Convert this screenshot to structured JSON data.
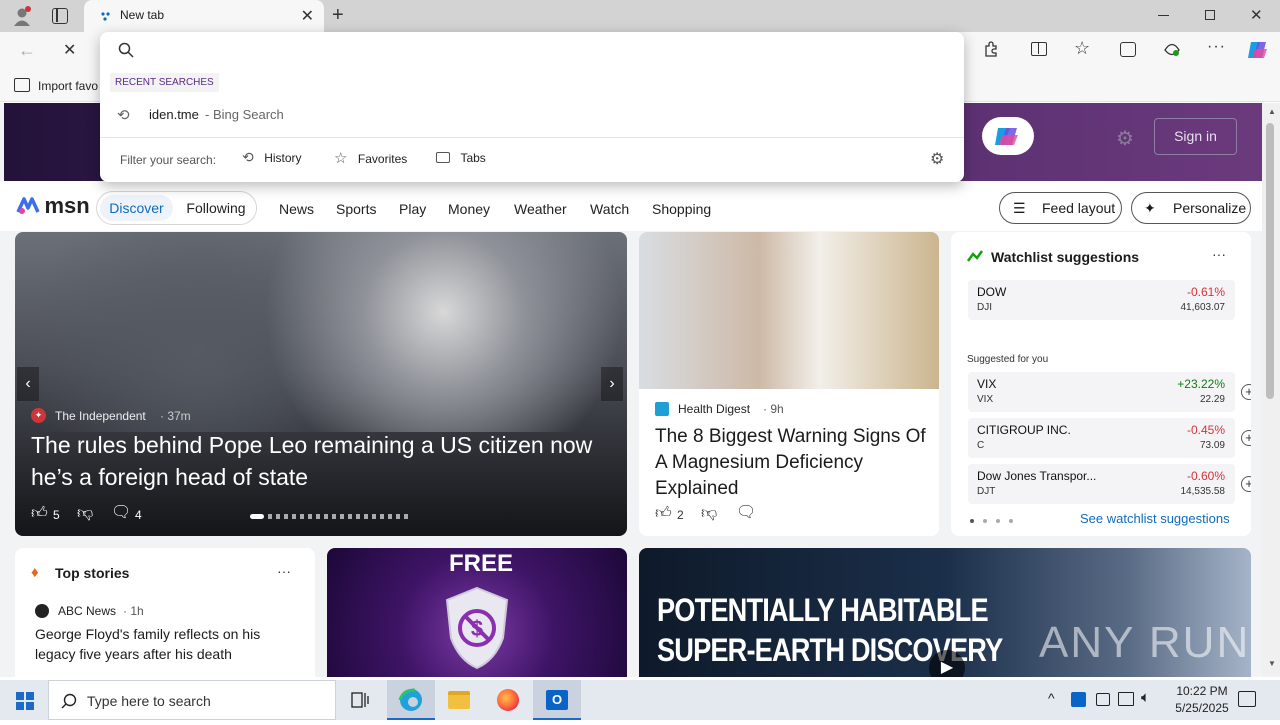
{
  "browser": {
    "tab_title": "New tab",
    "favorites_import": "Import favo",
    "omnibox": {
      "placeholder": "",
      "recent_label": "RECENT SEARCHES",
      "recent_item_query": "iden.tme",
      "recent_item_source": "- Bing Search",
      "filter_label": "Filter your search:",
      "filters": [
        "History",
        "Favorites",
        "Tabs"
      ]
    }
  },
  "msn": {
    "logo": "msn",
    "sign_in": "Sign in",
    "nav_tabs": [
      "Discover",
      "Following"
    ],
    "nav_links": [
      "News",
      "Sports",
      "Play",
      "Money",
      "Weather",
      "Watch",
      "Shopping"
    ],
    "feed_layout": "Feed layout",
    "personalize": "Personalize",
    "hero_story": {
      "source": "The Independent",
      "age": "· 37m",
      "headline": "The rules behind Pope Leo remaining a US citizen now he’s a foreign head of state",
      "likes": "5",
      "comments": "4"
    },
    "health_story": {
      "source": "Health Digest",
      "age": "· 9h",
      "headline": "The 8 Biggest Warning Signs Of A Magnesium Deficiency Explained",
      "likes": "2"
    },
    "watchlist": {
      "title": "Watchlist suggestions",
      "main": {
        "name": "DOW",
        "symbol": "DJI",
        "change": "-0.61%",
        "value": "41,603.07"
      },
      "suggested_label": "Suggested for you",
      "items": [
        {
          "name": "VIX",
          "symbol": "VIX",
          "change": "+23.22%",
          "value": "22.29",
          "color": "#0f7b0f"
        },
        {
          "name": "CITIGROUP INC.",
          "symbol": "C",
          "change": "-0.45%",
          "value": "73.09",
          "color": "#d13438"
        },
        {
          "name": "Dow Jones Transpor...",
          "symbol": "DJT",
          "change": "-0.60%",
          "value": "14,535.58",
          "color": "#d13438"
        }
      ],
      "see_all": "See watchlist suggestions"
    },
    "top_stories": {
      "title": "Top stories",
      "source": "ABC News",
      "age": "· 1h",
      "headline": "George Floyd's family reflects on his legacy five years after his death"
    },
    "ad_text": "FREE",
    "video_text_1": "POTENTIALLY HABITABLE",
    "video_text_2": "SUPER-EARTH DISCOVERY",
    "watermark": "ANY RUN"
  },
  "taskbar": {
    "search_placeholder": "Type here to search",
    "time": "10:22 PM",
    "date": "5/25/2025"
  },
  "colors": {
    "accent": "#0f6cbd",
    "negative": "#d13438",
    "positive": "#0f7b0f"
  }
}
